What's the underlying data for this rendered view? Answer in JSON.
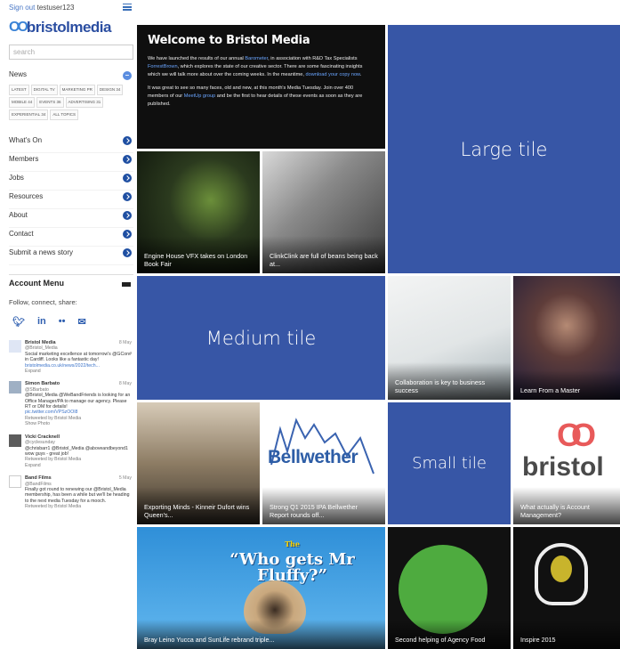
{
  "user": {
    "signout_label": "Sign out",
    "username": "testuser123"
  },
  "brand": {
    "name": "bristolmedia"
  },
  "search": {
    "placeholder": "search"
  },
  "news": {
    "heading": "News",
    "tags": [
      "LATEST",
      "DIGITAL TV",
      "MARKETING PR",
      "DESIGN 34",
      "MOBILE 44",
      "EVENTS 36",
      "ADVERTISING 31",
      "EXPERIENTIAL 34",
      "ALL TOPICS"
    ]
  },
  "nav": [
    {
      "label": "What's On"
    },
    {
      "label": "Members"
    },
    {
      "label": "Jobs"
    },
    {
      "label": "Resources"
    },
    {
      "label": "About"
    },
    {
      "label": "Contact"
    },
    {
      "label": "Submit a news story"
    }
  ],
  "account_menu": {
    "title": "Account Menu",
    "follow_label": "Follow, connect, share:"
  },
  "social_icons": [
    "twitter-icon",
    "linkedin-icon",
    "flickr-icon",
    "email-icon"
  ],
  "tweets": [
    {
      "name": "Bristol Media",
      "handle": "@Bristol_Media",
      "date": "8 May",
      "text": "Social marketing excellence at tomorrow's @GCon# in Cardiff. Looks like a fantastic day!",
      "link": "bristolmedia.co.uk/news/2022/tech...",
      "footer": "Expand"
    },
    {
      "name": "Simon Barbato",
      "handle": "@SBarbato",
      "date": "8 May",
      "text": "@Bristol_Media @WeBandFriends is looking for an Office Manager/PA to manage our agency. Please RT or DM for details!",
      "link": "pic.twitter.com/VPSzOOl8",
      "footer": "Retweeted by Bristol Media",
      "footer2": "Show Photo"
    },
    {
      "name": "Vicki Cracknell",
      "handle": "@cyclesunday",
      "date": "",
      "text": "@chrisbarr1 @Bristol_Media @aboveandbeyond1 wow guys - great job!",
      "link": "",
      "footer": "Retweeted by Bristol Media",
      "footer2": "Expand"
    },
    {
      "name": "Band Films",
      "handle": "@BandFilms",
      "date": "5 May",
      "text": "Finally got round to renewing our @Bristol_Media membership, has been a while but we'll be heading to the next media Tuesday for a mooch.",
      "link": "",
      "footer": "Retweeted by Bristol Media"
    }
  ],
  "welcome": {
    "title": "Welcome to Bristol Media",
    "para1_a": "We have launched the results of our annual ",
    "para1_link1": "Barometer",
    "para1_b": ", in association with R&D Tax Specialists ",
    "para1_link2": "ForrestBrown",
    "para1_c": ", which explores the state of our creative sector. There are some fascinating insights which we will talk more about over the coming weeks. In the meantime, ",
    "para1_link3": "download your copy now",
    "para1_d": ".",
    "para2_a": "It was great to see so many faces, old and new, at this month's Media Tuesday. Join over 400 members of our ",
    "para2_link": "MeetUp group",
    "para2_b": " and be the first to hear details of these events as soon as they are published."
  },
  "placeholders": {
    "large": "Large tile",
    "medium": "Medium tile",
    "small": "Small tile"
  },
  "tiles": {
    "engine_house": "Engine House VFX takes on London Book Fair",
    "clinkclink": "ClinkClink are full of beans being back at...",
    "collaboration": "Collaboration is key to business success",
    "master": "Learn From a Master",
    "exporting": "Exporting Minds - Kinneir Dufort wins Queen's...",
    "bellwether": "Strong Q1 2015 IPA Bellwether Report rounds off...",
    "bellwether_logo": "Bellwether",
    "account_mgmt": "What actually is Account Management?",
    "bristol_logo_word": "bristol",
    "bray": "Bray Leino Yucca and SunLife rebrand triple...",
    "mr_fluffy_the": "The",
    "mr_fluffy": "“Who gets Mr Fluffy?”",
    "agency_food": "Second helping of Agency Food",
    "inspire": "Inspire 2015"
  },
  "colors": {
    "tile_placeholder": "#3756a6",
    "accent": "#2b4ea1"
  }
}
